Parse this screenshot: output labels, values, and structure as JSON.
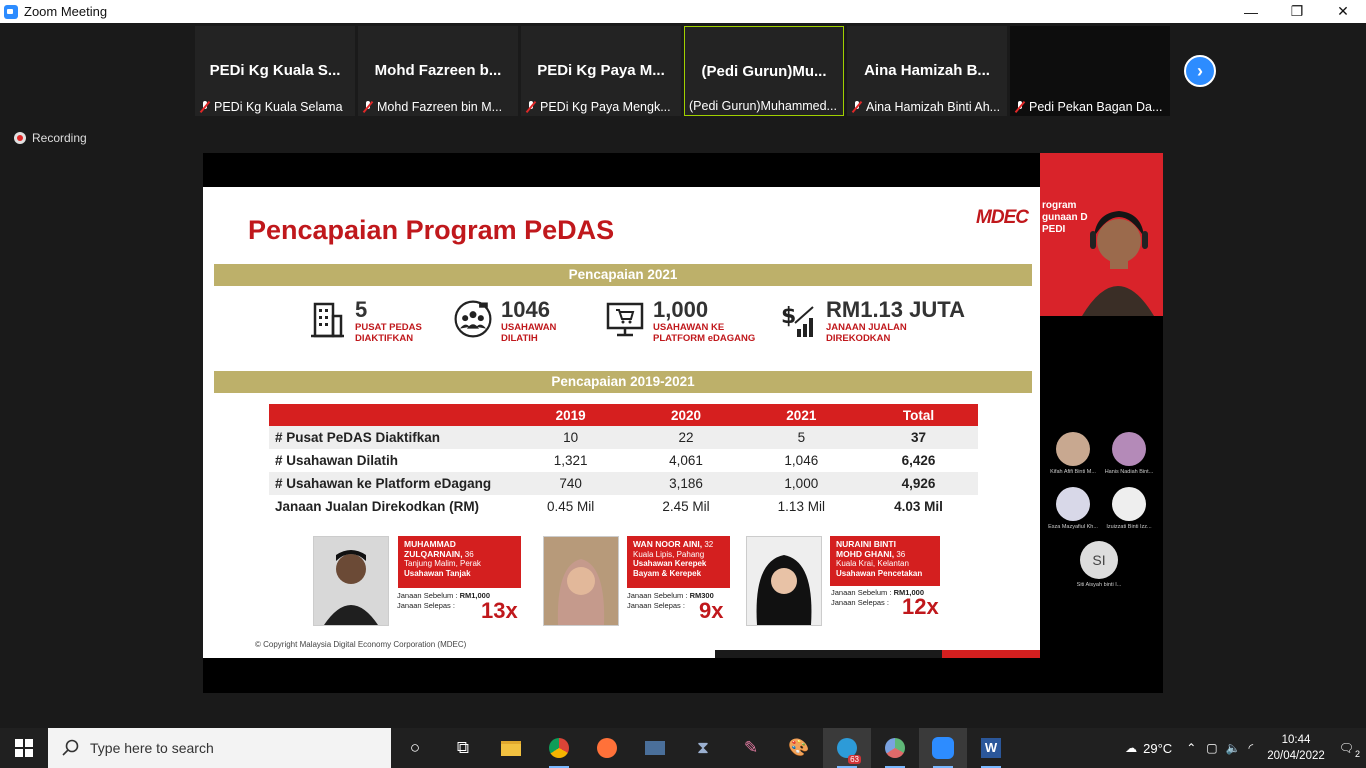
{
  "window": {
    "title": "Zoom Meeting",
    "minimize": "—",
    "maximize": "❐",
    "close": "✕"
  },
  "participants": [
    {
      "display": "PEDi Kg Kuala S...",
      "name": "PEDi Kg Kuala Selama"
    },
    {
      "display": "Mohd Fazreen b...",
      "name": "Mohd Fazreen bin M..."
    },
    {
      "display": "PEDi Kg Paya M...",
      "name": "PEDi Kg Paya Mengk..."
    },
    {
      "display": "(Pedi Gurun)Mu...",
      "name": "(Pedi Gurun)Muhammed..."
    },
    {
      "display": "Aina Hamizah B...",
      "name": "Aina Hamizah Binti Ah..."
    },
    {
      "display": "",
      "name": "Pedi Pekan Bagan Da..."
    }
  ],
  "recording_label": "Recording",
  "slide": {
    "title": "Pencapaian Program PeDAS",
    "logo": "MDEC",
    "band1": "Pencapaian 2021",
    "band2": "Pencapaian 2019-2021",
    "stats": [
      {
        "num": "5",
        "line1": "PUSAT PEDAS",
        "line2": "DIAKTIFKAN",
        "icon": "building-icon"
      },
      {
        "num": "1046",
        "line1": "USAHAWAN",
        "line2": "DILATIH",
        "icon": "group-training-icon"
      },
      {
        "num": "1,000",
        "line1": "USAHAWAN KE",
        "line2": "PLATFORM eDAGANG",
        "icon": "cart-monitor-icon"
      },
      {
        "num": "RM1.13 JUTA",
        "line1": "JANAAN JUALAN",
        "line2": "DIREKODKAN",
        "icon": "dollar-growth-icon"
      }
    ],
    "table": {
      "headers": [
        "",
        "2019",
        "2020",
        "2021",
        "Total"
      ],
      "rows": [
        [
          "# Pusat PeDAS Diaktifkan",
          "10",
          "22",
          "5",
          "37"
        ],
        [
          "# Usahawan Dilatih",
          "1,321",
          "4,061",
          "1,046",
          "6,426"
        ],
        [
          "# Usahawan ke Platform eDagang",
          "740",
          "3,186",
          "1,000",
          "4,926"
        ],
        [
          "Janaan Jualan Direkodkan (RM)",
          "0.45 Mil",
          "2.45 Mil",
          "1.13 Mil",
          "4.03 Mil"
        ]
      ]
    },
    "profiles": [
      {
        "name1": "MUHAMMAD",
        "name2": "ZULQARNAIN,",
        "age": "36",
        "place": "Tanjung Malim, Perak",
        "biz1": "Usahawan Tanjak",
        "biz2": "",
        "before_label": "Janaan Sebelum :",
        "before": "RM1,000",
        "after_label": "Janaan Selepas :",
        "mult": "13x"
      },
      {
        "name1": "WAN NOOR AINI,",
        "name2": "",
        "age": "32",
        "place": "Kuala Lipis, Pahang",
        "biz1": "Usahawan Kerepek",
        "biz2": "Bayam & Kerepek",
        "before_label": "Janaan Sebelum :",
        "before": "RM300",
        "after_label": "Janaan Selepas :",
        "mult": "9x"
      },
      {
        "name1": "NURAINI BINTI",
        "name2": "MOHD GHANI,",
        "age": "36",
        "place": "Kuala Krai, Kelantan",
        "biz1": "Usahawan Pencetakan",
        "biz2": "",
        "before_label": "Janaan Sebelum :",
        "before": "RM1,000",
        "after_label": "Janaan Selepas :",
        "mult": "12x"
      }
    ],
    "copyright": "© Copyright Malaysia Digital Economy Corporation (MDEC)"
  },
  "presenter_text": [
    "rogram",
    "gunaan D",
    "PEDI"
  ],
  "gallery": [
    {
      "name": "Kifah Afifi Binti M..."
    },
    {
      "name": "Hanis Nadiah Bint..."
    },
    {
      "name": "Esza Mazyafiul Kh..."
    },
    {
      "name": "Izuizzati Binti Izz..."
    },
    {
      "initials": "SI",
      "name": "Siti Aisyah binti I..."
    }
  ],
  "taskbar": {
    "search_placeholder": "Type here to search",
    "temperature": "29°C",
    "time": "10:44",
    "date": "20/04/2022",
    "badge": "63",
    "notifications": "2"
  }
}
